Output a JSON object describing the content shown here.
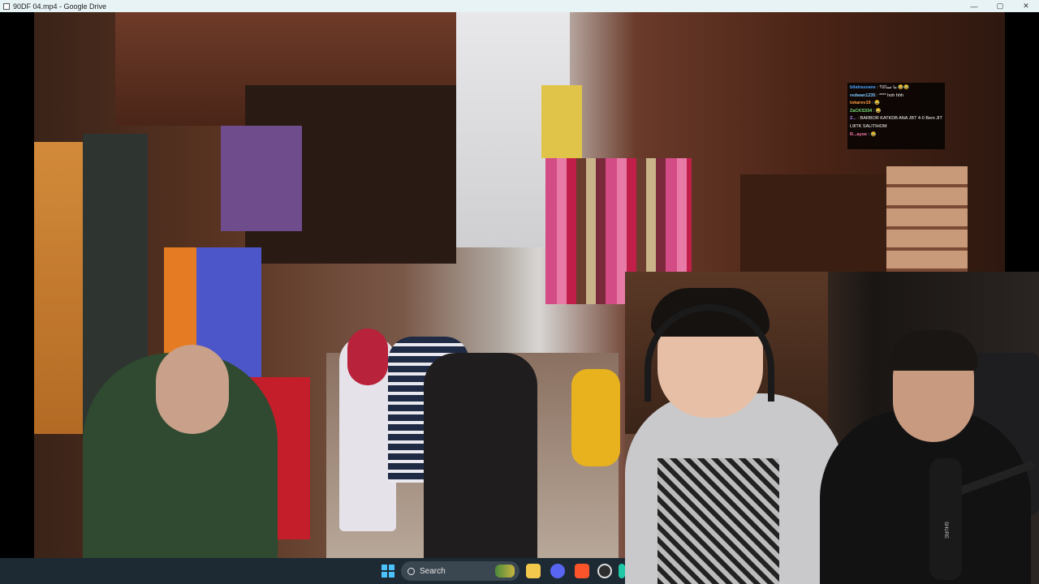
{
  "window": {
    "title": "90DF 04.mp4 - Google Drive",
    "minimize_glyph": "—",
    "maximize_glyph": "▢",
    "close_glyph": "✕"
  },
  "chat": {
    "messages": [
      {
        "user": "bilalrassane",
        "sep": ":",
        "text": "ما تساكا؟ 😂😂"
      },
      {
        "user": "redwan1235",
        "sep": ":",
        "text": "**** hoh hhh"
      },
      {
        "user": "tokarev19",
        "sep": ":",
        "text": "😂"
      },
      {
        "user": "ZaCKS334",
        "sep": ":",
        "text": "😂"
      },
      {
        "user": "Z...",
        "sep": ":",
        "text": "BARBOR KATKDB ANA JBT 4-0 Bem JIT L9lTK SALITIHOM"
      },
      {
        "user": "R...ayoe",
        "sep": ":",
        "text": "😂"
      }
    ]
  },
  "webcam": {
    "mic_brand": "SHURE"
  },
  "taskbar": {
    "search_placeholder": "Search",
    "apps": [
      "windows-start-icon",
      "search-icon",
      "file-explorer-icon",
      "discord-icon",
      "brave-icon",
      "obs-icon"
    ]
  },
  "colors": {
    "titlebar_bg": "#e7f3f5",
    "taskbar_bg": "#1d2a33",
    "accent_start": "#4cc2ff"
  }
}
